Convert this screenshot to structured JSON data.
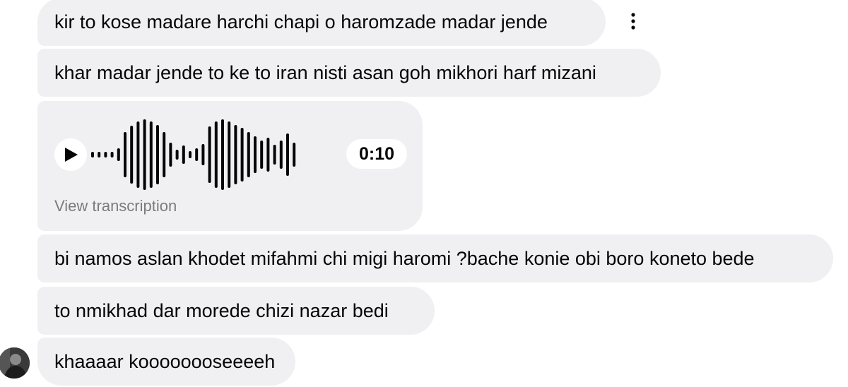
{
  "messages": [
    {
      "text": "kir to kose madare harchi chapi o haromzade madar jende"
    },
    {
      "text": "khar madar jende to ke to iran nisti asan goh mikhori harf mizani"
    },
    {
      "text": "bi namos aslan khodet mifahmi chi migi haromi ?bache konie obi boro koneto bede"
    },
    {
      "text": "to nmikhad dar morede chizi nazar bedi"
    },
    {
      "text": "khaaaar koooooooseeeeh"
    }
  ],
  "voice_message": {
    "duration": "0:10",
    "transcription_link": "View transcription",
    "play_icon": "play-icon"
  },
  "more_options_icon": "vertical-ellipsis-icon",
  "colors": {
    "bubble_bg": "#f0f0f2",
    "text": "#050505",
    "muted_text": "#7a7a80",
    "waveform": "#050505"
  }
}
